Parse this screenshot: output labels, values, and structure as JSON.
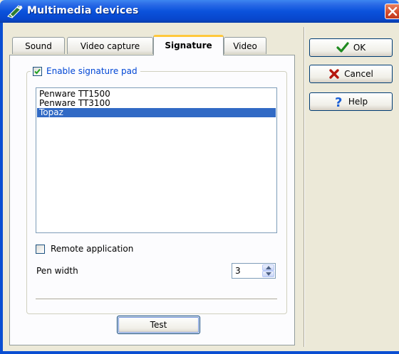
{
  "window": {
    "title": "Multimedia devices"
  },
  "tabs": [
    {
      "label": "Sound",
      "active": false
    },
    {
      "label": "Video capture",
      "active": false
    },
    {
      "label": "Signature",
      "active": true
    },
    {
      "label": "Video",
      "active": false
    }
  ],
  "signature": {
    "enable_label": "Enable signature pad",
    "enable_checked": true,
    "devices": [
      "Penware TT1500",
      "Penware TT3100",
      "Topaz"
    ],
    "selected_device": "Topaz",
    "remote_label": "Remote application",
    "remote_checked": false,
    "pen_width_label": "Pen width",
    "pen_width_value": "3",
    "test_label": "Test"
  },
  "buttons": {
    "ok_label": "OK",
    "cancel_label": "Cancel",
    "help_label": "Help"
  },
  "icons": [
    "multimedia-app-icon",
    "close-icon",
    "checkmark-icon",
    "cancel-x-icon",
    "help-question-icon",
    "spin-up-icon",
    "spin-down-icon"
  ],
  "colors": {
    "titlebar": "#0a52dc",
    "selection": "#316ac5",
    "legend_text": "#0046d5",
    "active_tab_accent": "#ffc83c"
  }
}
